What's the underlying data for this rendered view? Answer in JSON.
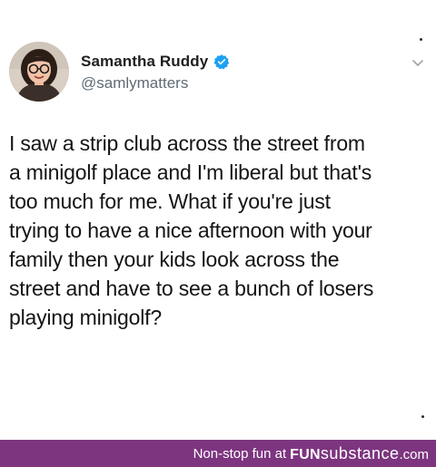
{
  "tweet": {
    "author": {
      "display_name": "Samantha Ruddy",
      "handle": "@samlymatters",
      "verified": true,
      "avatar_icon": "avatar-photo"
    },
    "text_lines": [
      "I saw a strip club across the street from",
      "a minigolf place and I'm liberal but that's",
      "too much for me. What if you're just",
      "trying to have a nice afternoon with your",
      "family then your kids look across the",
      "street and have to see a bunch of losers",
      "playing minigolf?"
    ],
    "menu_icon": "chevron-down-icon",
    "verified_color": "#1DA1F2"
  },
  "footer": {
    "tagline": "Non-stop fun at",
    "brand_fun": "FUN",
    "brand_substance": "substance",
    "brand_dotcom": ".com",
    "background_color": "#7D3580"
  }
}
